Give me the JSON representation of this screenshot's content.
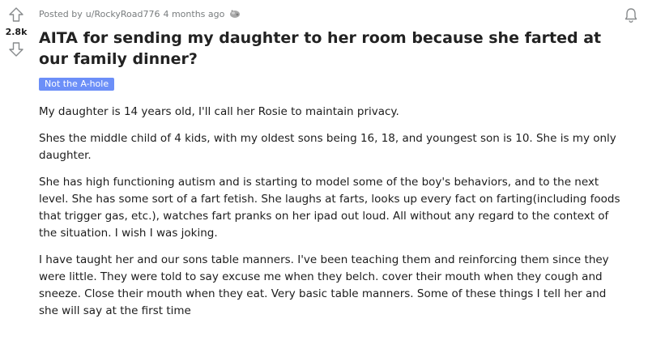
{
  "post": {
    "meta_prefix": "Posted by",
    "author": "u/RockyRoad776",
    "age": "4 months ago",
    "score": "2.8k",
    "title": "AITA for sending my daughter to her room because she farted at our family dinner?",
    "flair": "Not the A-hole",
    "paragraphs": [
      "My daughter is 14 years old, I'll call her Rosie to maintain privacy.",
      "Shes the middle child of 4 kids, with my oldest sons being 16, 18, and youngest son is 10. She is my only daughter.",
      "She has high functioning autism and is starting to model some of the boy's behaviors, and to the next level. She has some sort of a fart fetish. She laughs at farts, looks up every fact on farting(including foods that trigger gas, etc.), watches fart pranks on her ipad out loud. All without any regard to the context of the situation. I wish I was joking.",
      "I have taught her and our sons table manners. I've been teaching them and reinforcing them since they were little. They were told to say excuse me when they belch. cover their mouth when they cough and sneeze. Close their mouth when they eat. Very basic table manners. Some of these things I tell her and she will say at the first time"
    ]
  },
  "icons": {
    "upvote": "upvote-arrow-icon",
    "downvote": "downvote-arrow-icon",
    "award": "award-icon",
    "notify": "bell-icon"
  },
  "colors": {
    "flair_bg": "#6c8ff8",
    "meta_text": "#787c7e",
    "text": "#1c1c1c"
  }
}
